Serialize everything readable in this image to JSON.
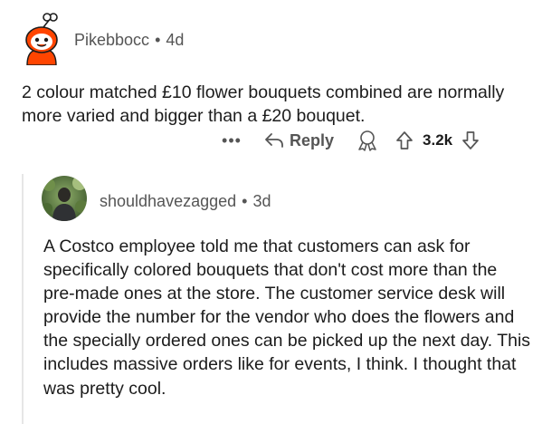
{
  "comment": {
    "author": "Pikebbocc",
    "age": "4d",
    "text": "2 colour matched £10 flower bouquets combined are normally more varied and bigger than a £20 bouquet.",
    "actions": {
      "more_label": "•••",
      "reply_label": "Reply",
      "score": "3.2k"
    },
    "icons": [
      "reddit-snoo-avatar-icon",
      "reply-arrow-icon",
      "award-icon",
      "upvote-icon",
      "downvote-icon"
    ]
  },
  "reply": {
    "author": "shouldhavezagged",
    "age": "3d",
    "text": "A Costco employee told me that customers can ask for specifically colored bouquets that don't cost more than the pre-made ones at the store. The customer service desk will provide the number for the vendor who does the flowers and the specially ordered ones can be picked up the next day. This includes massive orders like for events, I think. I thought that was pretty cool."
  },
  "separator": "•",
  "colors": {
    "text": "#1c1c1c",
    "meta": "#555555",
    "snoo_orange": "#ff4500",
    "thread_line": "#e6e6e6"
  }
}
